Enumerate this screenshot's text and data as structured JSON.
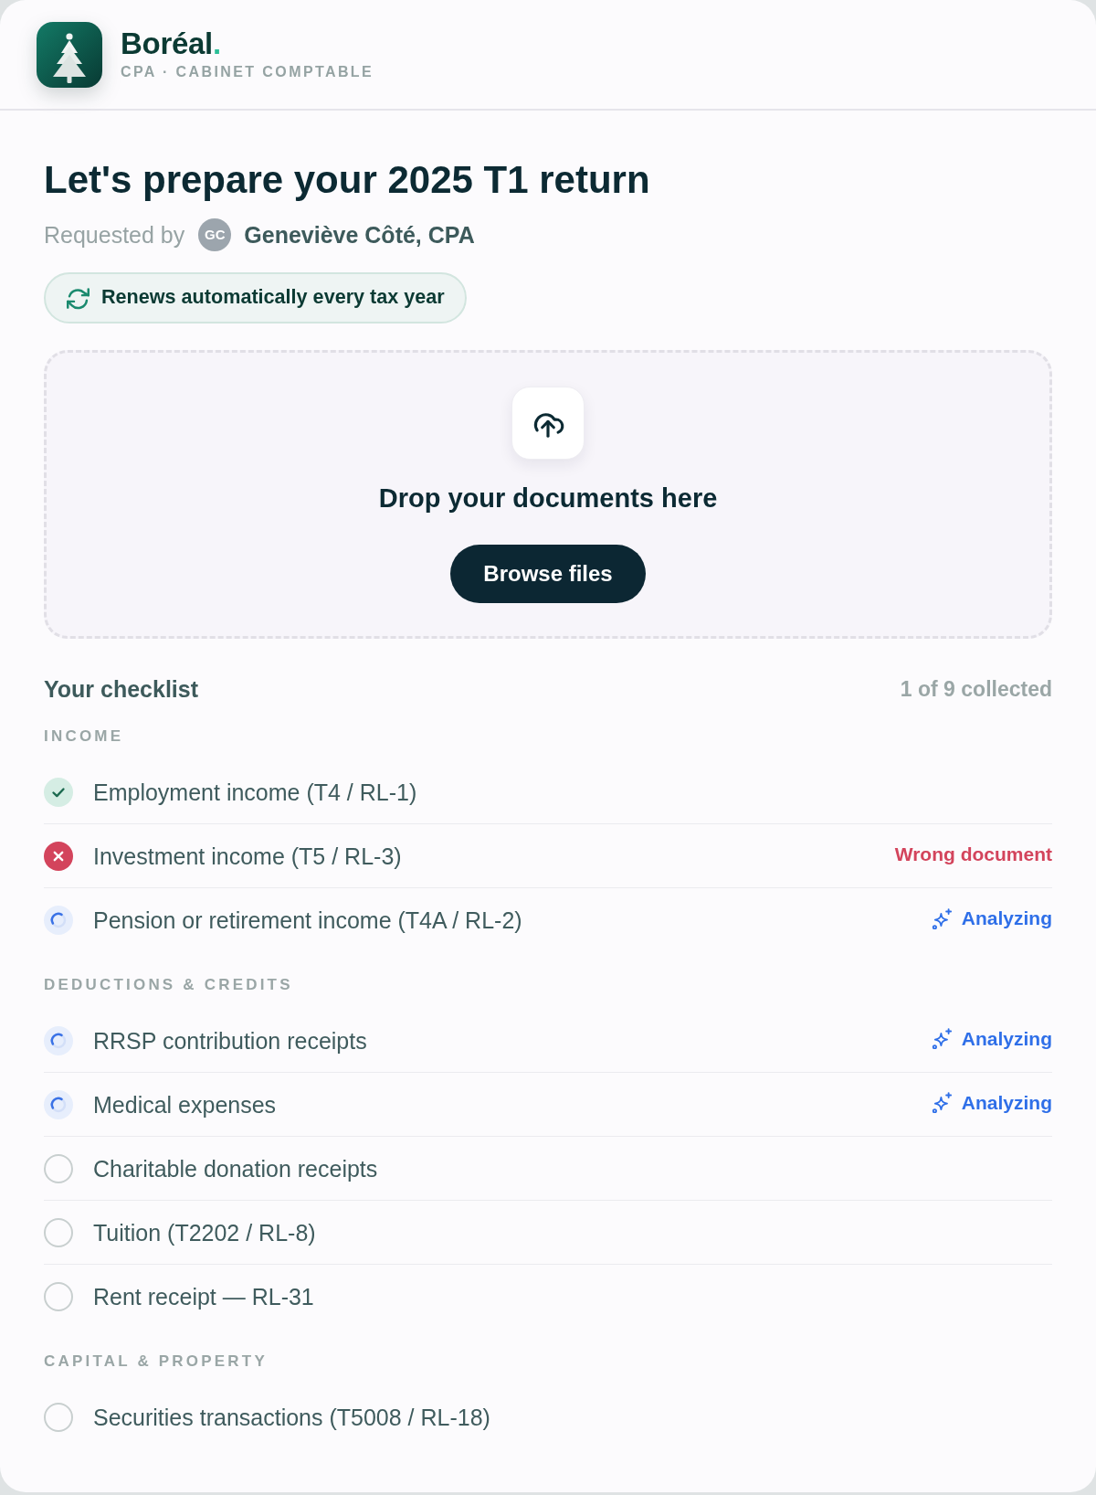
{
  "header": {
    "brand": {
      "name": "Boréal",
      "accent": ".",
      "tagline": "CPA · CABINET COMPTABLE"
    }
  },
  "title": "Let's prepare your 2025 T1 return",
  "requester": {
    "label": "Requested by",
    "initials": "GC",
    "name": "Geneviève Côté, CPA"
  },
  "renewal_badge": {
    "text": "Renews automatically every tax year"
  },
  "dropzone": {
    "heading": "Drop your documents here",
    "button": "Browse files"
  },
  "checklist": {
    "title": "Your checklist",
    "progress": "1 of 9 collected",
    "sections": [
      {
        "title": "INCOME",
        "items": [
          {
            "label": "Employment income (T4 / RL-1)",
            "kind": "collected"
          },
          {
            "label": "Investment income (T5 / RL-3)",
            "kind": "rejected",
            "note": "Wrong document"
          },
          {
            "label": "Pension or retirement income (T4A / RL-2)",
            "kind": "analyzing",
            "note": "Analyzing"
          }
        ]
      },
      {
        "title": "DEDUCTIONS & CREDITS",
        "items": [
          {
            "label": "RRSP contribution receipts",
            "kind": "analyzing",
            "note": "Analyzing"
          },
          {
            "label": "Medical expenses",
            "kind": "analyzing",
            "note": "Analyzing"
          },
          {
            "label": "Charitable donation receipts",
            "kind": "pending"
          },
          {
            "label": "Tuition (T2202 / RL-8)",
            "kind": "pending"
          },
          {
            "label": "Rent receipt — RL-31",
            "kind": "pending"
          }
        ]
      },
      {
        "title": "CAPITAL & PROPERTY",
        "items": [
          {
            "label": "Securities transactions (T5008 / RL-18)",
            "kind": "pending"
          }
        ]
      }
    ]
  }
}
